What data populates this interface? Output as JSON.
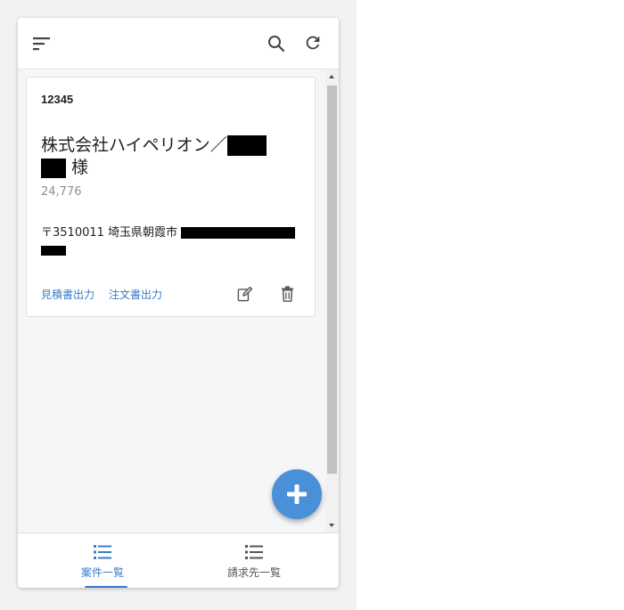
{
  "header": {
    "menu_icon": "sort-menu-icon",
    "search_icon": "search-icon",
    "refresh_icon": "refresh-icon"
  },
  "card": {
    "case_number": "12345",
    "customer_name_prefix": "株式会社ハイペリオン／",
    "customer_suffix": "様",
    "amount": "24,776",
    "address_prefix": "〒3510011 埼玉県朝霞市",
    "actions": {
      "estimate_label": "見積書出力",
      "order_label": "注文書出力"
    },
    "edit_icon": "edit-icon",
    "delete_icon": "delete-icon"
  },
  "fab": {
    "icon": "plus-icon"
  },
  "bottom_nav": {
    "items": [
      {
        "label": "案件一覧",
        "icon": "list-icon",
        "active": true
      },
      {
        "label": "請求先一覧",
        "icon": "list-icon",
        "active": false
      }
    ]
  },
  "colors": {
    "accent": "#3a7bc8",
    "fab": "#4a90d9",
    "redaction": "#000000"
  }
}
